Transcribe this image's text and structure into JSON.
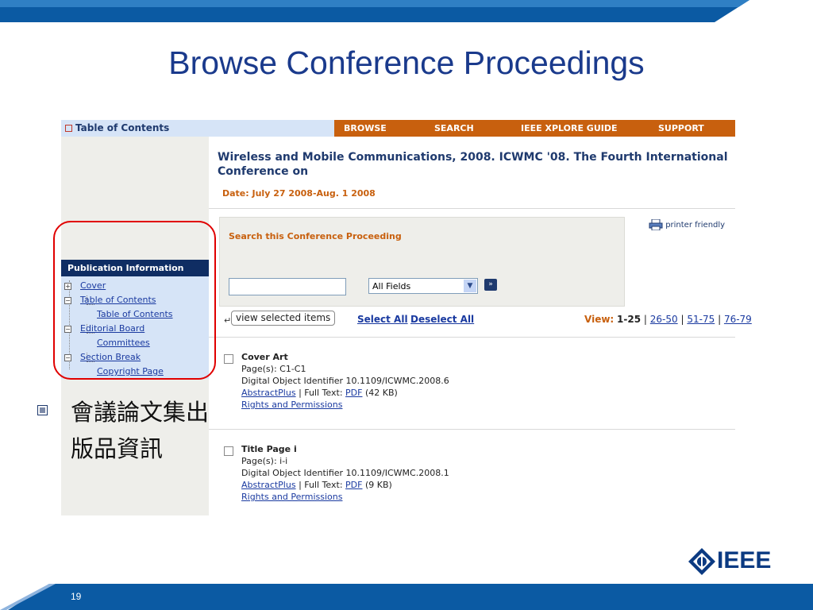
{
  "slide": {
    "title": "Browse Conference Proceedings",
    "bullet_text": "會議論文集出版品資訊",
    "page_number": "19",
    "logo_text": "IEEE"
  },
  "toc_bar": {
    "label": "Table of Contents"
  },
  "nav": {
    "items": [
      "BROWSE",
      "SEARCH",
      "IEEE XPLORE GUIDE",
      "SUPPORT"
    ]
  },
  "conference": {
    "title": "Wireless and Mobile Communications, 2008. ICWMC '08. The Fourth International Conference on",
    "date": "Date: July 27 2008-Aug. 1 2008"
  },
  "search": {
    "title": "Search this Conference Proceeding",
    "input_value": "",
    "field_selected": "All Fields",
    "printer_label": "printer friendly"
  },
  "pub_info": {
    "heading": "Publication Information",
    "items": [
      "Cover",
      "Table of Contents",
      "Table of Contents",
      "Editorial Board",
      "Committees",
      "Section Break",
      "Copyright Page"
    ]
  },
  "actions": {
    "view_selected": "view selected items",
    "select_all": "Select All",
    "deselect_all": "Deselect All",
    "view_label": "View:",
    "current_range": "1-25",
    "sep": "|",
    "ranges": [
      "26-50",
      "51-75",
      "76-79"
    ]
  },
  "results": [
    {
      "title": "Cover Art",
      "pages": "Page(s): C1-C1",
      "doi": "Digital Object Identifier 10.1109/ICWMC.2008.6",
      "abstract_link": "AbstractPlus",
      "fulltext_label": "| Full Text:",
      "pdf_link": "PDF",
      "size": "(42 KB)",
      "rights": "Rights and Permissions"
    },
    {
      "title": "Title Page i",
      "pages": "Page(s): i-i",
      "doi": "Digital Object Identifier 10.1109/ICWMC.2008.1",
      "abstract_link": "AbstractPlus",
      "fulltext_label": "| Full Text:",
      "pdf_link": "PDF",
      "size": "(9 KB)",
      "rights": "Rights and Permissions"
    }
  ],
  "colors": {
    "title_blue": "#1a3a8c",
    "nav_orange": "#c8600e",
    "panel_navy": "#0f2d63",
    "highlight_red": "#e00000"
  }
}
